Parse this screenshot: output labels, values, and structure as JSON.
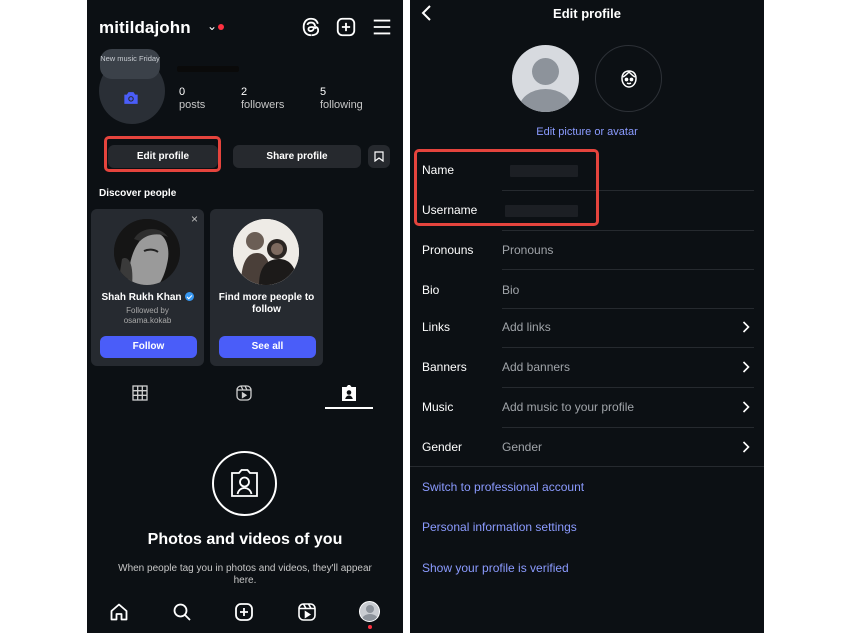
{
  "left": {
    "header": {
      "username": "mitildajohn",
      "chevron": "⌄",
      "icons": [
        "threads-icon",
        "create-post-icon",
        "menu-icon"
      ]
    },
    "profile": {
      "note": "New music Friday",
      "stats": [
        {
          "value": "0",
          "label": "posts"
        },
        {
          "value": "2",
          "label": "followers"
        },
        {
          "value": "5",
          "label": "following"
        }
      ],
      "edit_profile_label": "Edit profile",
      "share_profile_label": "Share profile"
    },
    "discover": {
      "title": "Discover people",
      "cards": [
        {
          "name": "Shah Rukh Khan",
          "sub": "Followed by osama.kokab",
          "button": "Follow",
          "close": "×"
        },
        {
          "name": "Find more people to follow",
          "button": "See all"
        }
      ]
    },
    "empty_state": {
      "title": "Photos and videos of you",
      "subtitle": "When people tag you in photos and videos, they'll appear here."
    },
    "accent_color": "#4a5df9",
    "highlight_color": "#e5443d"
  },
  "right": {
    "title": "Edit profile",
    "edit_picture_label": "Edit picture or avatar",
    "fields": {
      "name_label": "Name",
      "username_label": "Username",
      "pronouns_label": "Pronouns",
      "pronouns_value": "Pronouns",
      "bio_label": "Bio",
      "bio_value": "Bio",
      "links_label": "Links",
      "links_value": "Add links",
      "banners_label": "Banners",
      "banners_value": "Add banners",
      "music_label": "Music",
      "music_value": "Add music to your profile",
      "gender_label": "Gender",
      "gender_value": "Gender"
    },
    "links": {
      "professional": "Switch to professional account",
      "personal_info": "Personal information settings",
      "verified": "Show your profile is verified"
    },
    "link_color": "#8b9bff"
  }
}
